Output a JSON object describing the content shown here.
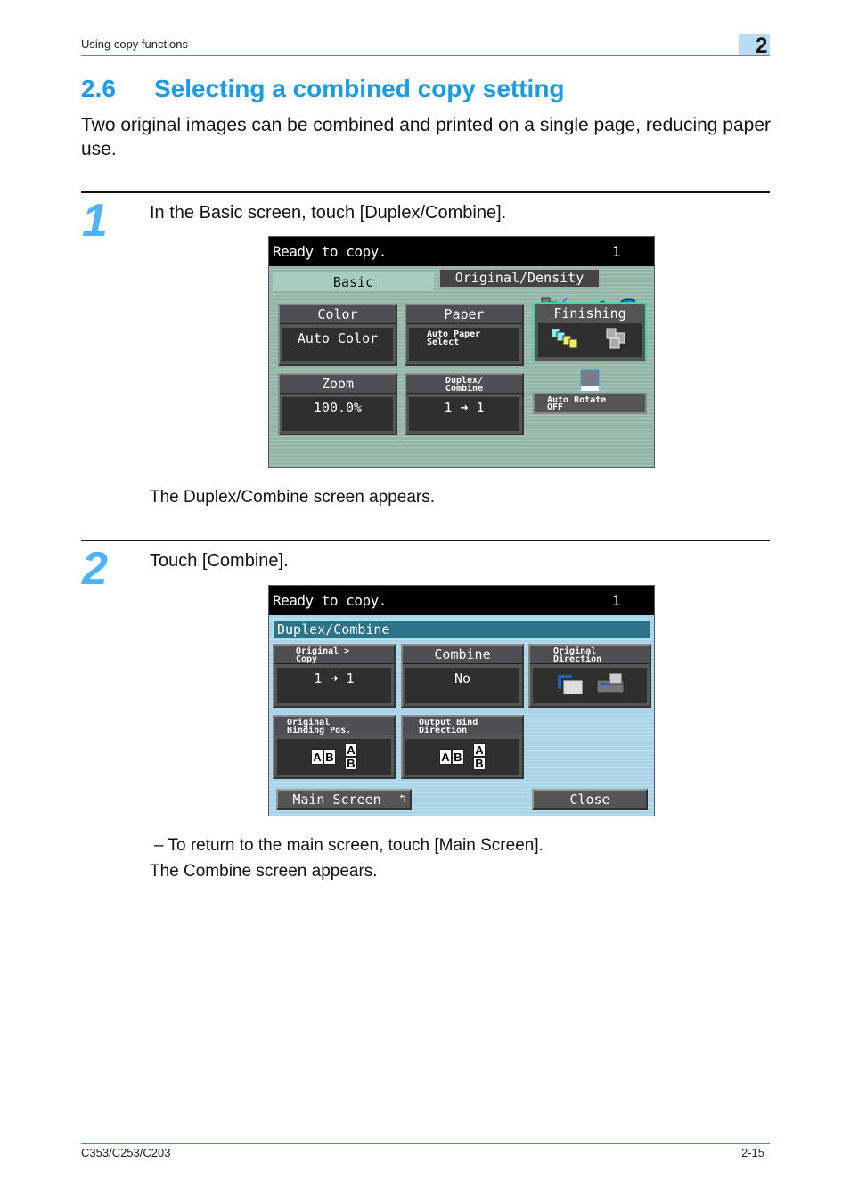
{
  "header": {
    "section_label": "Using copy functions",
    "chapter_number": "2"
  },
  "section": {
    "number": "2.6",
    "title": "Selecting a combined copy setting",
    "intro": "Two original images can be combined and printed on a single page, reducing paper use."
  },
  "steps": [
    {
      "number": "1",
      "instruction": "In the Basic screen, touch [Duplex/Combine].",
      "result": "The Duplex/Combine screen appears."
    },
    {
      "number": "2",
      "instruction": "Touch [Combine].",
      "note": "–  To return to the main screen, touch [Main Screen].",
      "result": "The Combine screen appears."
    }
  ],
  "screen1": {
    "status": "Ready to copy.",
    "copies": "1",
    "tabs": {
      "basic": "Basic",
      "original_density": "Original/Density"
    },
    "buttons": {
      "color": {
        "label": "Color",
        "value": "Auto Color"
      },
      "paper": {
        "label": "Paper",
        "value_line1": "Auto Paper",
        "value_line2": "Select"
      },
      "zoom": {
        "label": "Zoom",
        "value": "100.0%"
      },
      "duplex": {
        "label_line1": "Duplex/",
        "label_line2": "Combine",
        "value": "1 ➜ 1"
      },
      "finishing": {
        "label": "Finishing"
      },
      "auto_rotate": {
        "line1": "Auto Rotate",
        "line2": "OFF"
      }
    },
    "colors": {
      "background": "#93b6a8",
      "status_bar": "#000000",
      "finishing_border": "#3fd6a0"
    }
  },
  "screen2": {
    "status": "Ready to copy.",
    "copies": "1",
    "title": "Duplex/Combine",
    "buttons": {
      "original_copy": {
        "label_line1": "Original >",
        "label_line2": "Copy",
        "value": "1 ➜ 1"
      },
      "combine": {
        "label": "Combine",
        "value": "No"
      },
      "original_direction": {
        "label_line1": "Original",
        "label_line2": "Direction"
      },
      "original_binding": {
        "label_line1": "Original",
        "label_line2": "Binding Pos."
      },
      "output_bind": {
        "label_line1": "Output Bind",
        "label_line2": "Direction"
      },
      "main_screen": "Main Screen",
      "close": "Close"
    },
    "page_glyphs": {
      "a": "A",
      "b": "B"
    },
    "colors": {
      "background": "#a9d3e6",
      "title_bar": "#2b7388"
    }
  },
  "footer": {
    "model": "C353/C253/C203",
    "page": "2-15"
  },
  "colors": {
    "accent": "#1a9be6",
    "step_number": "#4cb3ff"
  }
}
